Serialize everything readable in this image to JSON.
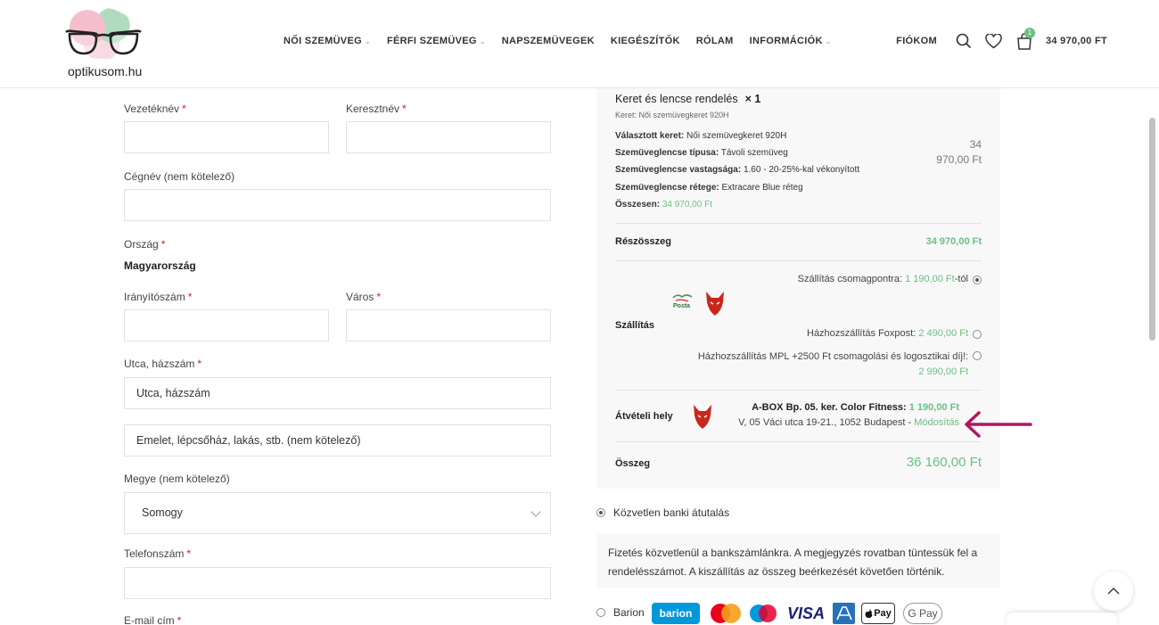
{
  "header": {
    "logo_text": "optikusom.hu",
    "nav": [
      {
        "label": "NŐI SZEMÜVEG",
        "dropdown": true
      },
      {
        "label": "FÉRFI SZEMÜVEG",
        "dropdown": true
      },
      {
        "label": "NAPSZEMÜVEGEK",
        "dropdown": false
      },
      {
        "label": "KIEGÉSZÍTŐK",
        "dropdown": false
      },
      {
        "label": "RÓLAM",
        "dropdown": false
      },
      {
        "label": "INFORMÁCIÓK",
        "dropdown": true
      }
    ],
    "account": "FIÓKOM",
    "cart_count": "1",
    "cart_total": "34 970,00 FT"
  },
  "form": {
    "last_name_label": "Vezetéknév",
    "first_name_label": "Keresztnév",
    "company_label": "Cégnév (nem kötelező)",
    "country_label": "Ország",
    "country_value": "Magyarország",
    "zip_label": "Irányítószám",
    "city_label": "Város",
    "street_label": "Utca, házszám",
    "street_placeholder": "Utca, házszám",
    "street2_placeholder": "Emelet, lépcsőház, lakás, stb. (nem kötelező)",
    "county_label": "Megye (nem kötelező)",
    "county_value": "Somogy",
    "phone_label": "Telefonszám",
    "email_label": "E-mail cím",
    "required_mark": "*"
  },
  "order": {
    "product_name": "Keret és lencse rendelés",
    "product_qty": "× 1",
    "product_sub": "Keret: Női szemüvegkeret 920H",
    "price_line1": "34",
    "price_line2": "970,00 Ft",
    "meta": [
      {
        "key": "Választott keret:",
        "value": "Női szemüvegkeret 920H"
      },
      {
        "key": "Szemüveglencse típusa:",
        "value": "Távoli szemüveg"
      },
      {
        "key": "Szemüveglencse vastagsága:",
        "value": "1.60 - 20-25%-kal vékonyított"
      },
      {
        "key": "Szemüveglencse rétege:",
        "value": "Extracare Blue réteg"
      }
    ],
    "total_meta_key": "Összesen:",
    "total_meta_value": "34 970,00 Ft",
    "subtotal_label": "Részösszeg",
    "subtotal_value": "34 970,00 Ft",
    "shipping_label": "Szállítás",
    "shipping_options": [
      {
        "text": "Szállítás csomagpontra:",
        "price": "1 190,00 Ft",
        "suffix": "-tól",
        "selected": true
      },
      {
        "text": "Házhozszállítás Foxpost:",
        "price": "2 490,00 Ft",
        "suffix": "",
        "selected": false
      },
      {
        "text": "Házhozszállítás MPL +2500 Ft csomagolási és logosztikai díj!:",
        "price": "2 990,00 Ft",
        "suffix": "",
        "selected": false
      }
    ],
    "posta_text": "Posta",
    "pickup_label": "Átvételi hely",
    "pickup_name": "A-BOX Bp. 05. ker. Color Fitness:",
    "pickup_price": "1 190,00 Ft",
    "pickup_address": "V, 05 Váci utca 19-21., 1052 Budapest -",
    "pickup_modify": "Módosítás",
    "grand_total_label": "Összeg",
    "grand_total_value": "36 160,00 Ft"
  },
  "payment": {
    "bank_label": "Közvetlen banki átutalás",
    "bank_desc": "Fizetés közvetlenül a bankszámlánkra. A megjegyzés rovatban tüntessük fel a rendelésszámot. A kiszállítás az összeg beérkezését követően történik.",
    "barion_label": "Barion",
    "logos": [
      "barion",
      "VISA",
      "Pay",
      "G Pay"
    ]
  },
  "colors": {
    "accent_green": "#6cbf84",
    "required_red": "#e01a1a",
    "arrow_magenta": "#b0185f"
  }
}
